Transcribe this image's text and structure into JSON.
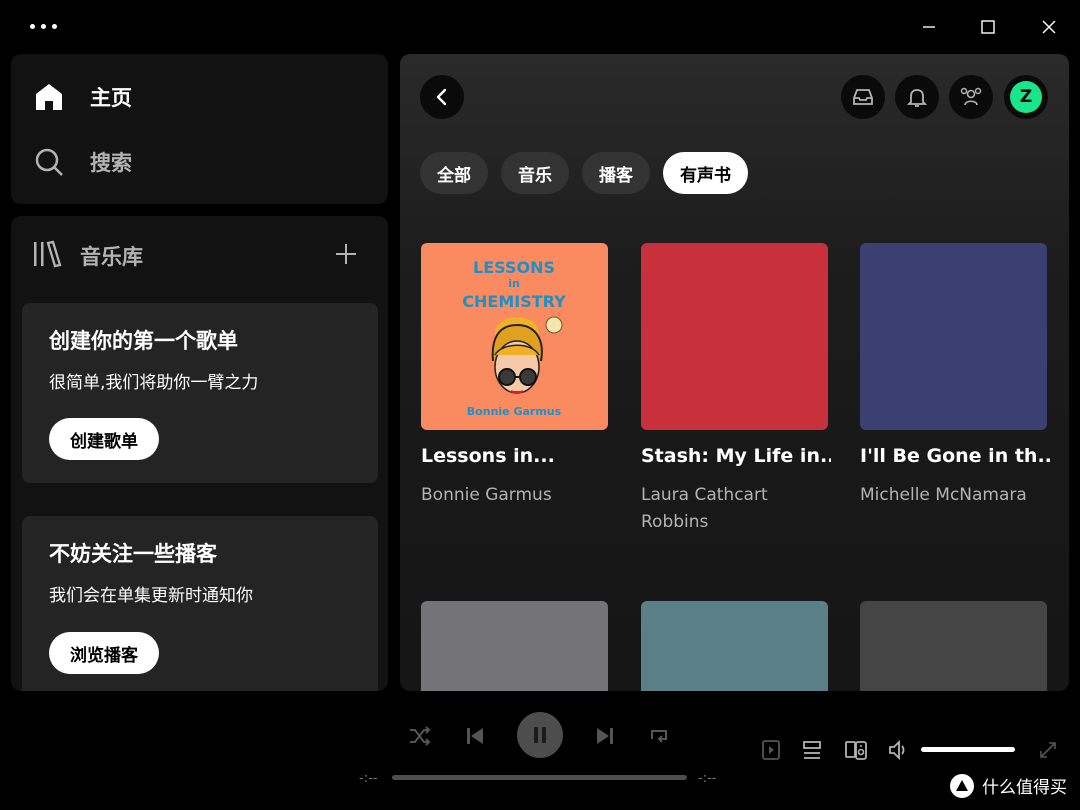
{
  "nav": {
    "home": "主页",
    "search": "搜索"
  },
  "library": {
    "title": "音乐库",
    "playlist_card": {
      "title": "创建你的第一个歌单",
      "subtitle": "很简单,我们将助你一臂之力",
      "button": "创建歌单"
    },
    "podcast_card": {
      "title": "不妨关注一些播客",
      "subtitle": "我们会在单集更新时通知你",
      "button": "浏览播客"
    }
  },
  "header": {
    "avatar_letter": "Z"
  },
  "filters": [
    {
      "label": "全部",
      "active": false
    },
    {
      "label": "音乐",
      "active": false
    },
    {
      "label": "播客",
      "active": false
    },
    {
      "label": "有声书",
      "active": true
    }
  ],
  "audiobooks": [
    {
      "title": "Lessons in...",
      "author": "Bonnie Garmus",
      "color": "#fa8a5f",
      "cover": {
        "line1": "LESSONS",
        "line2": "in",
        "line3": "CHEMISTRY",
        "author": "Bonnie Garmus"
      }
    },
    {
      "title": "Stash: My Life in...",
      "author": "Laura Cathcart Robbins",
      "color": "#c8303c"
    },
    {
      "title": "I'll Be Gone in th...",
      "author": "Michelle McNamara",
      "color": "#3b4071"
    },
    {
      "color": "#737378"
    },
    {
      "color": "#5a7f87"
    },
    {
      "color": "#454545"
    }
  ],
  "player": {
    "time_elapsed": "-:--",
    "time_total": "-:--",
    "volume_level": 1.0
  },
  "icons": [
    "home-icon",
    "search-icon",
    "library-icon",
    "plus-icon",
    "back-icon",
    "inbox-icon",
    "bell-icon",
    "friends-icon",
    "shuffle-icon",
    "previous-icon",
    "pause-icon",
    "next-icon",
    "repeat-icon",
    "now-playing-icon",
    "queue-icon",
    "device-icon",
    "volume-icon",
    "fullscreen-icon"
  ],
  "watermark": "什么值得买"
}
